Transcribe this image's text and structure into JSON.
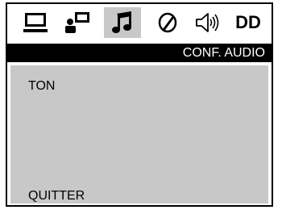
{
  "tabs": [
    {
      "id": "general",
      "icon": "monitor-icon"
    },
    {
      "id": "video",
      "icon": "person-monitor-icon"
    },
    {
      "id": "audio",
      "icon": "music-note-icon",
      "active": true
    },
    {
      "id": "preference",
      "icon": "slash-circle-icon"
    },
    {
      "id": "speaker",
      "icon": "speaker-icon"
    },
    {
      "id": "dolby",
      "icon": "dd-text-icon",
      "label": "DD"
    }
  ],
  "header": {
    "title": "CONF. AUDIO"
  },
  "menu": {
    "items": [
      "TON",
      "QUITTER"
    ]
  },
  "colors": {
    "accent": "#000000",
    "panel": "#c8c8c8",
    "active_tab": "#c8c8c8"
  }
}
